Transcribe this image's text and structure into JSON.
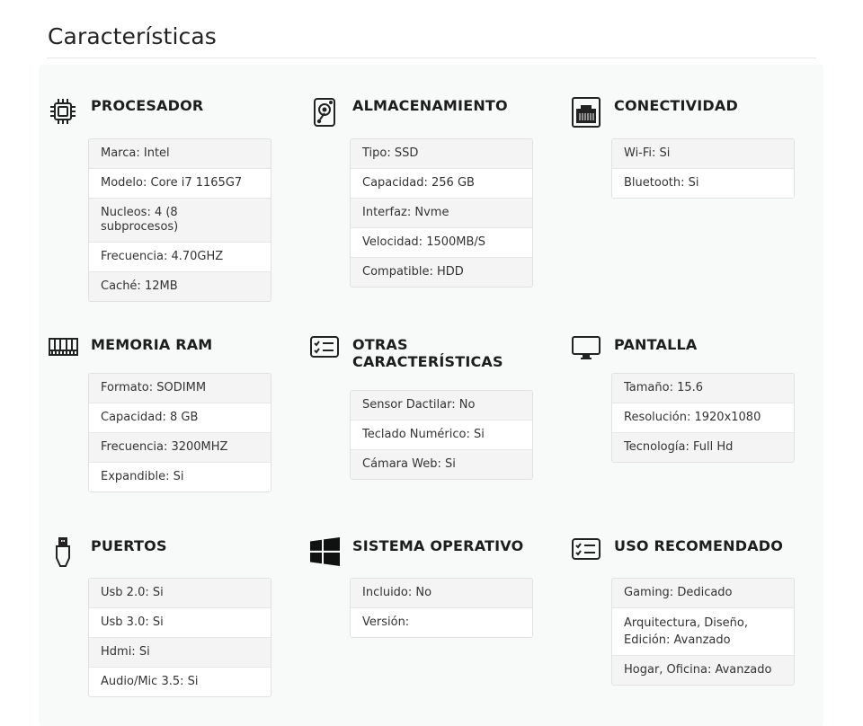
{
  "page": {
    "title": "Características"
  },
  "sections": [
    {
      "key": "procesador",
      "title": "PROCESADOR",
      "icon": "cpu-icon",
      "rows": [
        "Marca: Intel",
        "Modelo: Core i7 1165G7",
        "Nucleos: 4 (8 subprocesos)",
        "Frecuencia: 4.70GHZ",
        "Caché: 12MB"
      ]
    },
    {
      "key": "almacenamiento",
      "title": "ALMACENAMIENTO",
      "icon": "hard-drive-icon",
      "rows": [
        "Tipo: SSD",
        "Capacidad: 256 GB",
        "Interfaz: Nvme",
        "Velocidad: 1500MB/S",
        "Compatible: HDD"
      ]
    },
    {
      "key": "conectividad",
      "title": "CONECTIVIDAD",
      "icon": "ethernet-port-icon",
      "rows": [
        "Wi-Fi: Si",
        "Bluetooth: Si"
      ]
    },
    {
      "key": "memoria",
      "title": "MEMORIA RAM",
      "icon": "ram-icon",
      "rows": [
        "Formato: SODIMM",
        "Capacidad: 8 GB",
        "Frecuencia: 3200MHZ",
        "Expandible: Si"
      ]
    },
    {
      "key": "otras",
      "title": "OTRAS CARACTERÍSTICAS",
      "icon": "checklist-icon",
      "rows": [
        "Sensor Dactilar: No",
        "Teclado Numérico: Si",
        "Cámara Web: Si"
      ]
    },
    {
      "key": "pantalla",
      "title": "PANTALLA",
      "icon": "monitor-icon",
      "rows": [
        "Tamaño: 15.6",
        "Resolución: 1920x1080",
        "Tecnología: Full Hd"
      ]
    },
    {
      "key": "puertos",
      "title": "PUERTOS",
      "icon": "usb-icon",
      "rows": [
        "Usb 2.0: Si",
        "Usb 3.0: Si",
        "Hdmi: Si",
        "Audio/Mic 3.5: Si"
      ]
    },
    {
      "key": "sistema",
      "title": "SISTEMA OPERATIVO",
      "icon": "windows-logo-icon",
      "rows": [
        "Incluido: No",
        "Versión:"
      ]
    },
    {
      "key": "uso",
      "title": "USO RECOMENDADO",
      "icon": "checklist-icon",
      "rows": [
        "Gaming: Dedicado",
        "Arquitectura, Diseño, Edición: Avanzado",
        "Hogar, Oficina: Avanzado"
      ]
    }
  ]
}
